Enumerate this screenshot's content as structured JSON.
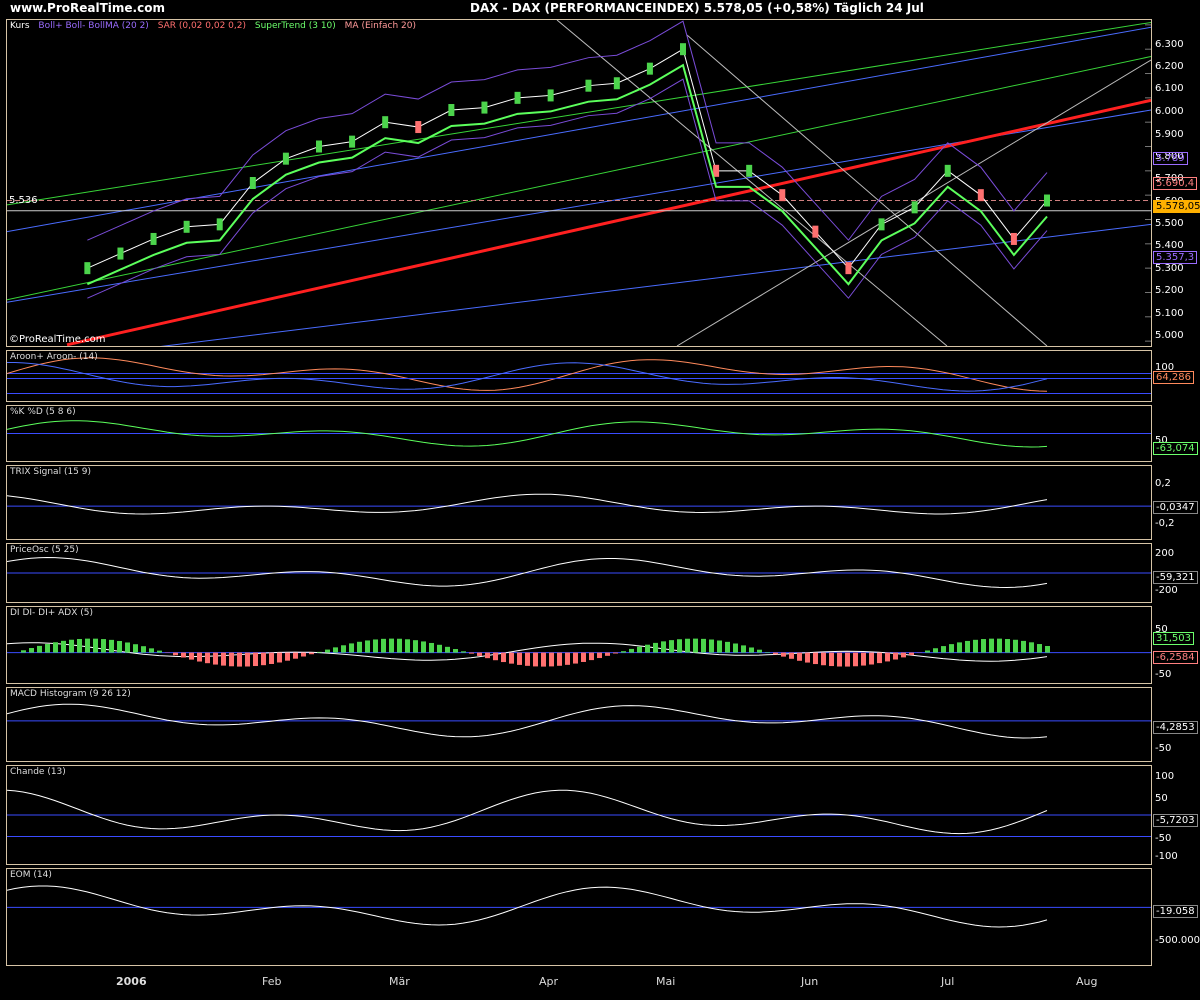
{
  "header": {
    "site": "www.ProRealTime.com",
    "title": "DAX - DAX (PERFORMANCEINDEX)   5.578,05 (+0,58%)   Täglich  24 Jul"
  },
  "price_panel": {
    "labels": [
      "Kurs",
      "Boll+ Boll- BollMA (20 2)",
      "SAR (0,02 0,02 0,2)",
      "SuperTrend (3 10)",
      "MA (Einfach 20)"
    ],
    "label_colors": [
      "#ffffff",
      "#9a6cff",
      "#ff6f6f",
      "#6cff6c",
      "#ff9a9a"
    ],
    "left_label": "5.536",
    "copyright": "©ProRealTime.com",
    "ticks": [
      "6.300",
      "6.200",
      "6.100",
      "6.000",
      "5.900",
      "5.800",
      "5.700",
      "5.600",
      "5.500",
      "5.400",
      "5.300",
      "5.200",
      "5.100",
      "5.000"
    ],
    "tags": [
      {
        "text": "5.789",
        "color": "#9a6cff"
      },
      {
        "text": "5.690,4",
        "color": "#ff8080"
      },
      {
        "text": "5.578,05",
        "color": "#ffb000"
      },
      {
        "text": "5.357,3",
        "color": "#9a6cff"
      }
    ]
  },
  "aroon": {
    "label": "Aroon+ Aroon- (14)",
    "ticks": [
      "100"
    ],
    "tag": "64,286"
  },
  "stoch": {
    "label": "%K %D (5 8 6)",
    "ticks": [
      "50"
    ],
    "tag": "-63,074"
  },
  "trix": {
    "label": "TRIX Signal (15 9)",
    "ticks": [
      "0,2",
      "-0,2"
    ],
    "tag": "-0,0347"
  },
  "priceosc": {
    "label": "PriceOsc (5 25)",
    "ticks": [
      "200",
      "-200"
    ],
    "tag": "-59,321"
  },
  "adx": {
    "label": "DI DI- DI+ ADX (5)",
    "ticks": [
      "50",
      "-50"
    ],
    "tags": [
      "31,503",
      "-6,2584"
    ]
  },
  "macd": {
    "label": "MACD Histogram (9 26 12)",
    "ticks": [
      "-50"
    ],
    "tag": "-4,2853"
  },
  "chande": {
    "label": "Chande (13)",
    "ticks": [
      "100",
      "50",
      "-50",
      "-100"
    ],
    "tag": "-5,7203"
  },
  "eom": {
    "label": "EOM (14)",
    "ticks": [
      "-500.000"
    ],
    "tag": "-19.058"
  },
  "xaxis": {
    "labels": [
      "2006",
      "Feb",
      "Mär",
      "Apr",
      "Mai",
      "Jun",
      "Jul",
      "Aug"
    ]
  },
  "chart_data": {
    "type": "line",
    "title": "DAX - DAX (PERFORMANCEINDEX)",
    "x": [
      "2006-01-02",
      "2006-01-09",
      "2006-01-16",
      "2006-01-23",
      "2006-01-30",
      "2006-02-06",
      "2006-02-13",
      "2006-02-20",
      "2006-02-27",
      "2006-03-06",
      "2006-03-13",
      "2006-03-20",
      "2006-03-27",
      "2006-04-03",
      "2006-04-10",
      "2006-04-18",
      "2006-04-24",
      "2006-05-01",
      "2006-05-08",
      "2006-05-15",
      "2006-05-22",
      "2006-05-29",
      "2006-06-05",
      "2006-06-12",
      "2006-06-19",
      "2006-06-26",
      "2006-07-03",
      "2006-07-10",
      "2006-07-17",
      "2006-07-24"
    ],
    "series": [
      {
        "values": [
          5300,
          5360,
          5420,
          5470,
          5480,
          5650,
          5750,
          5800,
          5820,
          5900,
          5880,
          5950,
          5960,
          6000,
          6010,
          6050,
          6060,
          6120,
          6200,
          5700,
          5700,
          5600,
          5450,
          5300,
          5480,
          5550,
          5700,
          5600,
          5420,
          5578
        ]
      }
    ],
    "ylim": [
      4980,
      6320
    ]
  }
}
